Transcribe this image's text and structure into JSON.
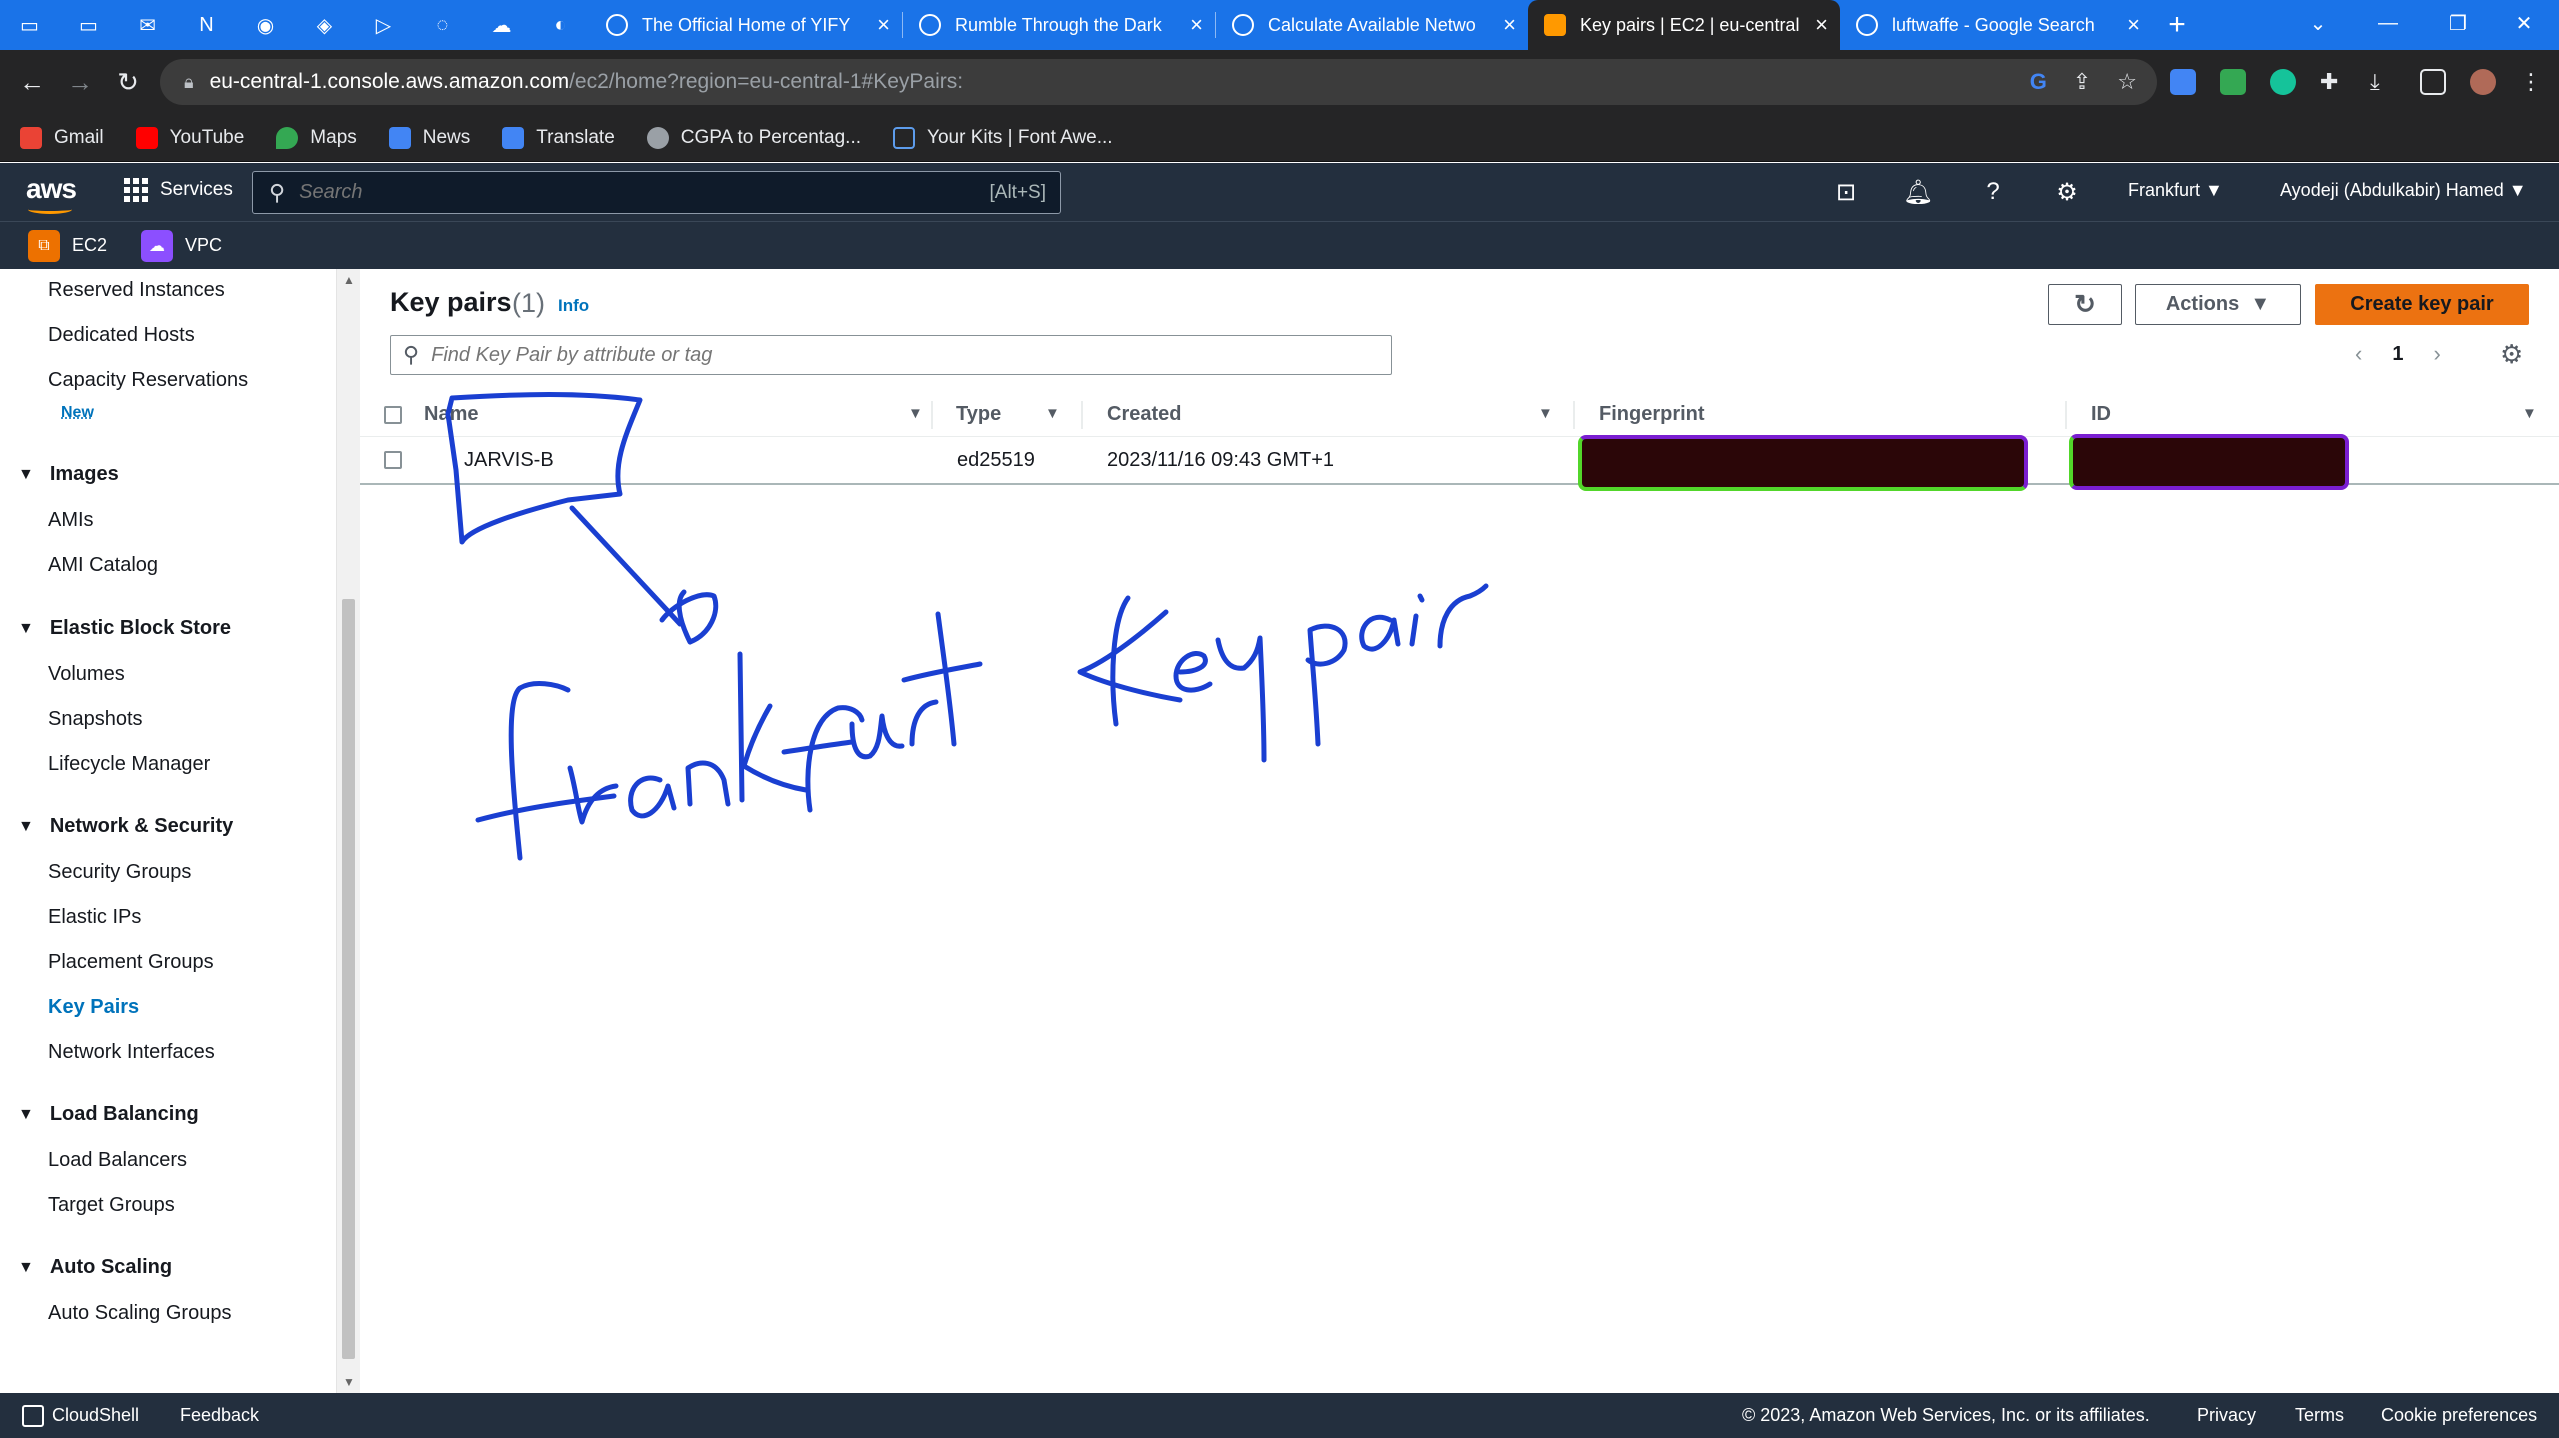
{
  "browser": {
    "pinned_tabs": [
      {
        "icon": "folder-icon"
      },
      {
        "icon": "folder-icon"
      },
      {
        "icon": "mail-icon"
      },
      {
        "icon": "notion-icon"
      },
      {
        "icon": "app-icon"
      },
      {
        "icon": "app-icon"
      },
      {
        "icon": "app-icon"
      },
      {
        "icon": "app-icon"
      },
      {
        "icon": "cloud-icon"
      },
      {
        "icon": "app-icon"
      }
    ],
    "tabs": [
      {
        "title": "The Official Home of YIFY",
        "active": false
      },
      {
        "title": "Rumble Through the Dark",
        "active": false
      },
      {
        "title": "Calculate Available Netwo",
        "active": false
      },
      {
        "title": "Key pairs | EC2 | eu-central",
        "active": true
      },
      {
        "title": "luftwaffe - Google Search",
        "active": false
      }
    ],
    "url_host": "eu-central-1.console.aws.amazon.com",
    "url_path": "/ec2/home?region=eu-central-1#KeyPairs:",
    "bookmarks": [
      {
        "label": "Gmail",
        "color": "#ea4335"
      },
      {
        "label": "YouTube",
        "color": "#ff0000"
      },
      {
        "label": "Maps",
        "color": "#34a853"
      },
      {
        "label": "News",
        "color": "#4285f4"
      },
      {
        "label": "Translate",
        "color": "#4285f4"
      },
      {
        "label": "CGPA to Percentag...",
        "color": "#9aa0a6"
      },
      {
        "label": "Your Kits | Font Awe...",
        "color": "#5d9cec"
      }
    ]
  },
  "aws": {
    "logo": "aws",
    "services_label": "Services",
    "search_placeholder": "Search",
    "search_shortcut": "[Alt+S]",
    "region": "Frankfurt",
    "user": "Ayodeji (Abdulkabir) Hamed",
    "service_shortcuts": [
      {
        "label": "EC2",
        "color": "#ed7100"
      },
      {
        "label": "VPC",
        "color": "#8c4fff"
      }
    ]
  },
  "sidebar": {
    "items": [
      {
        "label": "Reserved Instances",
        "type": "item"
      },
      {
        "label": "Dedicated Hosts",
        "type": "item"
      },
      {
        "label": "Capacity Reservations",
        "type": "item"
      },
      {
        "label": "New",
        "type": "badge"
      },
      {
        "label": "Images",
        "type": "section"
      },
      {
        "label": "AMIs",
        "type": "item"
      },
      {
        "label": "AMI Catalog",
        "type": "item"
      },
      {
        "label": "Elastic Block Store",
        "type": "section"
      },
      {
        "label": "Volumes",
        "type": "item"
      },
      {
        "label": "Snapshots",
        "type": "item"
      },
      {
        "label": "Lifecycle Manager",
        "type": "item"
      },
      {
        "label": "Network & Security",
        "type": "section"
      },
      {
        "label": "Security Groups",
        "type": "item"
      },
      {
        "label": "Elastic IPs",
        "type": "item"
      },
      {
        "label": "Placement Groups",
        "type": "item"
      },
      {
        "label": "Key Pairs",
        "type": "item",
        "active": true
      },
      {
        "label": "Network Interfaces",
        "type": "item"
      },
      {
        "label": "Load Balancing",
        "type": "section"
      },
      {
        "label": "Load Balancers",
        "type": "item"
      },
      {
        "label": "Target Groups",
        "type": "item"
      },
      {
        "label": "Auto Scaling",
        "type": "section"
      },
      {
        "label": "Auto Scaling Groups",
        "type": "item"
      }
    ]
  },
  "main": {
    "title": "Key pairs",
    "count": "(1)",
    "info_link": "Info",
    "actions_label": "Actions",
    "create_label": "Create key pair",
    "filter_placeholder": "Find Key Pair by attribute or tag",
    "page_number": "1",
    "columns": [
      "Name",
      "Type",
      "Created",
      "Fingerprint",
      "ID"
    ],
    "rows": [
      {
        "name": "JARVIS-B",
        "type": "ed25519",
        "created": "2023/11/16 09:43 GMT+1",
        "fingerprint": "",
        "id": ""
      }
    ]
  },
  "annotation": {
    "text": "frankfurt Keypair",
    "color": "#1a3fd1"
  },
  "footer": {
    "cloudshell": "CloudShell",
    "feedback": "Feedback",
    "copyright": "© 2023, Amazon Web Services, Inc. or its affiliates.",
    "privacy": "Privacy",
    "terms": "Terms",
    "cookies": "Cookie preferences"
  }
}
